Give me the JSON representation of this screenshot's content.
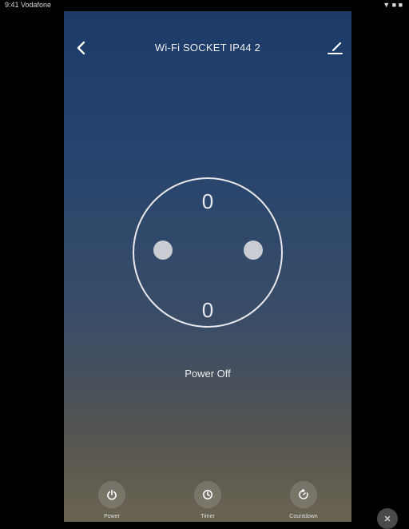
{
  "status_bar": {
    "time": "9:41 Vodafone",
    "indicators": "▼ ■ ■"
  },
  "header": {
    "title": "Wi-Fi SOCKET IP44 2",
    "back_icon": "chevron-left-icon",
    "edit_icon": "edit-pencil-icon"
  },
  "socket": {
    "icon": "socket-outlet-icon",
    "top_contact": "0",
    "bottom_contact": "0"
  },
  "status": {
    "label": "Power Off"
  },
  "actions": [
    {
      "label": "Power",
      "icon": "power-icon"
    },
    {
      "label": "Timer",
      "icon": "timer-icon"
    },
    {
      "label": "Countdown",
      "icon": "countdown-icon"
    }
  ],
  "colors": {
    "bg_top": "#1b3a68",
    "bg_bottom": "#6a6452",
    "socket_pin": "#c9ccd3",
    "text": "#f0f0f0"
  }
}
